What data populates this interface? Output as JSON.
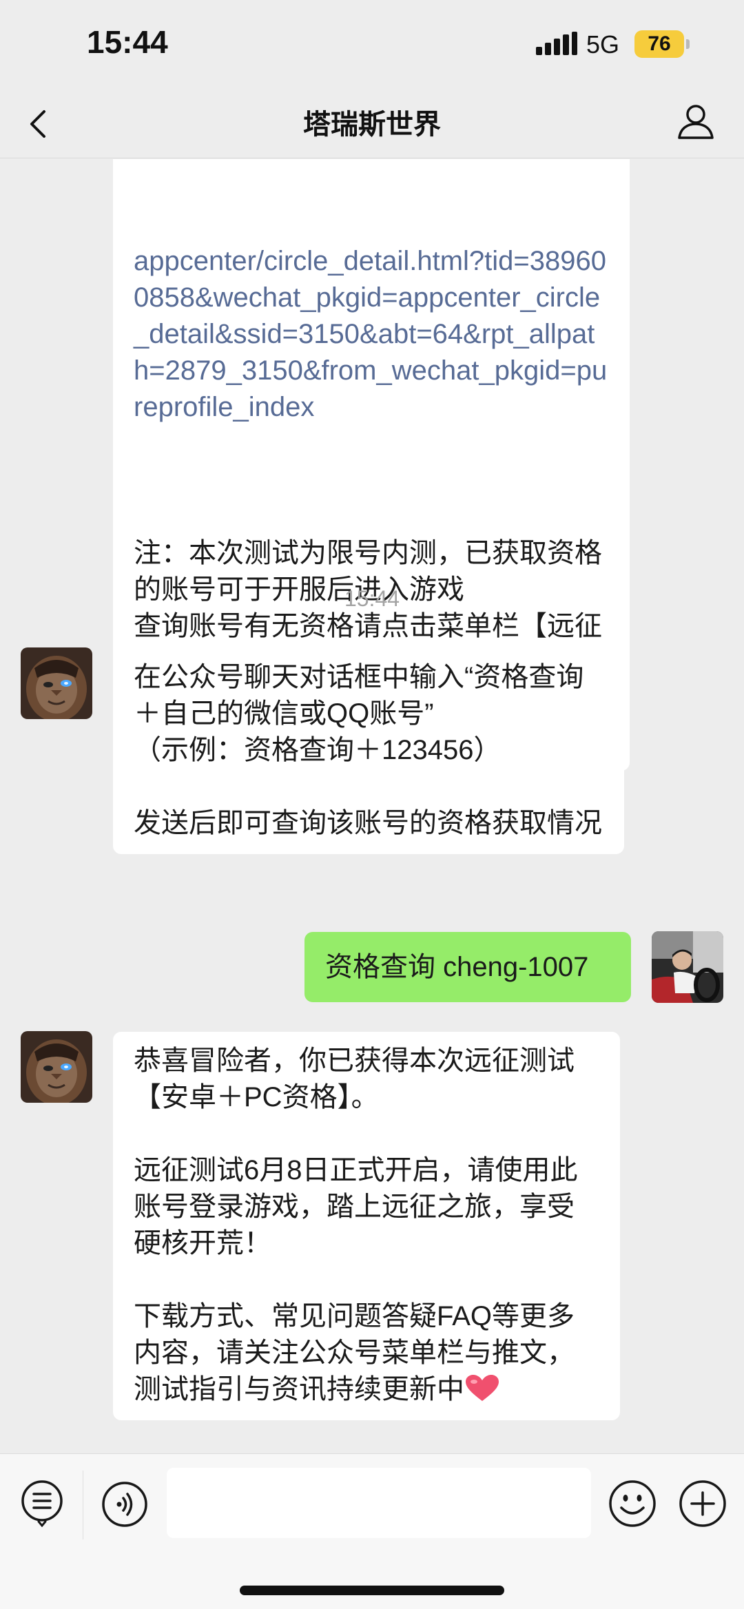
{
  "status_bar": {
    "time": "15:44",
    "network": "5G",
    "battery": "76"
  },
  "header": {
    "title": "塔瑞斯世界"
  },
  "chat": {
    "link_message": {
      "link": "appcenter/circle_detail.html?tid=389600858&wechat_pkgid=appcenter_circle_detail&ssid=3150&abt=64&rpt_allpath=2879_3150&from_wechat_pkgid=pureprofile_index",
      "note": "注：本次测试为限号内测，已获取资格的账号可于开服后进入游戏\n查询账号有无资格请点击菜单栏【远征测试】→【资格查询】"
    },
    "timestamp": "15:44",
    "messages": [
      {
        "sender": "account",
        "text": "在公众号聊天对话框中输入“资格查询＋自己的微信或QQ账号”\n（示例：资格查询＋123456）\n\n发送后即可查询该账号的资格获取情况"
      },
      {
        "sender": "me",
        "text": "资格查询 cheng-1007"
      },
      {
        "sender": "account",
        "text": "恭喜冒险者，你已获得本次远征测试【安卓＋PC资格】。\n\n远征测试6月8日正式开启，请使用此账号登录游戏，踏上远征之旅，享受硬核开荒！\n\n下载方式、常见问题答疑FAQ等更多内容，请关注公众号菜单栏与推文，测试指引与资讯持续更新中"
      }
    ]
  },
  "input_bar": {
    "placeholder": ""
  },
  "icons": {
    "back": "chevron-left-icon",
    "profile": "person-icon",
    "menu": "menu-list-icon",
    "voice": "voice-icon",
    "emoji": "smiley-icon",
    "plus": "plus-icon",
    "heart": "heart-icon"
  },
  "colors": {
    "link": "#576b95",
    "sent_bubble": "#95ec69",
    "battery": "#f6cc3c",
    "background": "#ededed"
  }
}
